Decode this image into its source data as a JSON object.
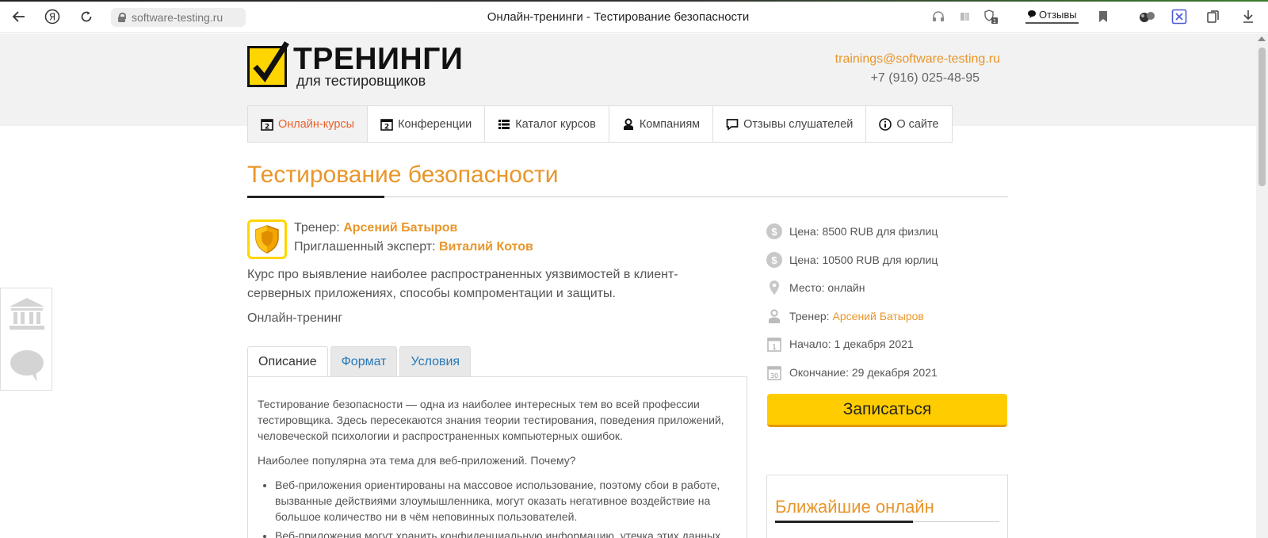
{
  "browser": {
    "url": "software-testing.ru",
    "tab_title": "Онлайн-тренинги - Тестирование безопасности",
    "reviews_label": "Отзывы"
  },
  "header": {
    "logo_title": "ТРЕНИНГИ",
    "logo_subtitle": "для тестировщиков",
    "email": "trainings@software-testing.ru",
    "phone": "+7 (916) 025-48-95"
  },
  "nav": {
    "items": [
      {
        "label": "Онлайн-курсы",
        "icon": "calendar-icon"
      },
      {
        "label": "Конференции",
        "icon": "calendar-icon"
      },
      {
        "label": "Каталог курсов",
        "icon": "list-icon"
      },
      {
        "label": "Компаниям",
        "icon": "person-icon"
      },
      {
        "label": "Отзывы слушателей",
        "icon": "comment-icon"
      },
      {
        "label": "О сайте",
        "icon": "info-icon"
      }
    ]
  },
  "course": {
    "title": "Тестирование безопасности",
    "trainer_label": "Тренер:",
    "trainer_name": "Арсений Батыров",
    "expert_label": "Приглашенный эксперт:",
    "expert_name": "Виталий Котов",
    "description": "Курс про выявление наиболее распространенных уязвимостей в клиент-серверных приложениях, способы компроментации и защиты.",
    "format": "Онлайн-тренинг"
  },
  "tabs": [
    {
      "label": "Описание",
      "active": true
    },
    {
      "label": "Формат",
      "active": false
    },
    {
      "label": "Условия",
      "active": false
    }
  ],
  "tab_content": {
    "p1": "Тестирование безопасности — одна из наиболее интересных тем во всей профессии тестировщика. Здесь пересекаются знания теории тестирования, поведения приложений, человеческой психологии и распространенных компьютерных ошибок.",
    "p2": "Наиболее популярна эта тема для веб-приложений. Почему?",
    "bullets": [
      "Веб-приложения ориентированы на массовое использование, поэтому сбои в работе, вызванные действиями злоумышленника, могут оказать негативное воздействие на большое количество ни в чём неповинных пользователей.",
      "Веб-приложения могут хранить конфиденциальную информацию, утечка этих данных"
    ]
  },
  "sidebar": {
    "price_individual": "Цена: 8500 RUB для физлиц",
    "price_company": "Цена: 10500 RUB для юрлиц",
    "place": "Место: онлайн",
    "trainer_label": "Тренер:",
    "trainer_name": "Арсений Батыров",
    "start": "Начало: 1 декабря 2021",
    "end": "Окончание: 29 декабря 2021",
    "start_day": "1",
    "end_day": "30",
    "signup_label": "Записаться",
    "upcoming_title": "Ближайшие онлайн"
  },
  "colors": {
    "accent": "#e8962a",
    "active_nav": "#e8602a",
    "button": "#ffcc00",
    "tab_link": "#2779b8"
  }
}
